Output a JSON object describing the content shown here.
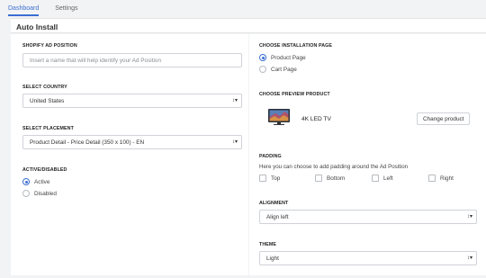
{
  "tabs": [
    {
      "label": "Dashboard"
    },
    {
      "label": "Settings"
    }
  ],
  "page": {
    "title": "Auto Install"
  },
  "left": {
    "ad_position_label": "SHOPIFY AD POSITION",
    "ad_position_placeholder": "Insert a name that will help identify your Ad Position",
    "country_label": "SELECT COUNTRY",
    "country_value": "United States",
    "placement_label": "SELECT PLACEMENT",
    "placement_value": "Product Detail - Price Detail (350 x 100) - EN",
    "status_label": "ACTIVE/DISABLED",
    "status_options": [
      {
        "label": "Active",
        "selected": true
      },
      {
        "label": "Disabled",
        "selected": false
      }
    ]
  },
  "right": {
    "install_page_label": "CHOOSE INSTALLATION PAGE",
    "install_page_options": [
      {
        "label": "Product Page",
        "selected": true
      },
      {
        "label": "Cart Page",
        "selected": false
      }
    ],
    "preview_label": "CHOOSE PREVIEW PRODUCT",
    "product_name": "4K LED TV",
    "change_product_label": "Change product",
    "padding_label": "PADDING",
    "padding_help": "Here you can choose to add padding around the Ad Position",
    "padding_options": [
      {
        "label": "Top"
      },
      {
        "label": "Bottom"
      },
      {
        "label": "Left"
      },
      {
        "label": "Right"
      }
    ],
    "alignment_label": "ALIGNMENT",
    "alignment_value": "Align left",
    "theme_label": "THEME",
    "theme_value": "Light"
  },
  "icons": {
    "select_caret": "↕▾",
    "product_thumbnail": "tv-thumbnail-icon"
  },
  "colors": {
    "accent": "#3b6fd1",
    "background": "#f2f3f5",
    "panel": "#ffffff",
    "border": "#cfd3d8"
  }
}
